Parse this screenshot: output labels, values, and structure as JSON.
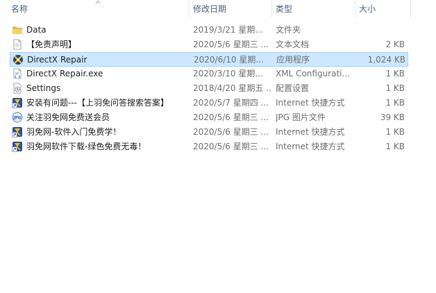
{
  "columns": {
    "name": "名称",
    "date": "修改日期",
    "type": "类型",
    "size": "大小"
  },
  "files": [
    {
      "name": "Data",
      "date": "2019/3/21 星期...",
      "type": "文件夹",
      "size": "",
      "icon": "folder-icon",
      "selected": false
    },
    {
      "name": "【免责声明】",
      "date": "2020/5/6 星期三 ...",
      "type": "文本文档",
      "size": "2 KB",
      "icon": "text-file-icon",
      "selected": false
    },
    {
      "name": "DirectX Repair",
      "date": "2020/6/10 星期...",
      "type": "应用程序",
      "size": "1,024 KB",
      "icon": "directx-app-icon",
      "selected": true
    },
    {
      "name": "DirectX Repair.exe",
      "date": "2020/3/10 星期...",
      "type": "XML Configurati...",
      "size": "1 KB",
      "icon": "xml-file-icon",
      "selected": false
    },
    {
      "name": "Settings",
      "date": "2018/4/20 星期五 ...",
      "type": "配置设置",
      "size": "1 KB",
      "icon": "settings-file-icon",
      "selected": false
    },
    {
      "name": "安装有问题---【上羽免问答搜索答案】",
      "date": "2020/5/7 星期四 ...",
      "type": "Internet 快捷方式",
      "size": "1 KB",
      "icon": "internet-shortcut-icon",
      "selected": false
    },
    {
      "name": "关注羽免网免费送会员",
      "date": "2020/5/6 星期三 ...",
      "type": "JPG 图片文件",
      "size": "39 KB",
      "icon": "jpg-file-icon",
      "selected": false
    },
    {
      "name": "羽免网-软件入门免费学！",
      "date": "2020/5/6 星期三 ...",
      "type": "Internet 快捷方式",
      "size": "1 KB",
      "icon": "internet-shortcut-icon",
      "selected": false
    },
    {
      "name": "羽免网软件下载-绿色免费无毒！",
      "date": "2020/5/6 星期三 ...",
      "type": "Internet 快捷方式",
      "size": "1 KB",
      "icon": "internet-shortcut-icon",
      "selected": false
    }
  ]
}
